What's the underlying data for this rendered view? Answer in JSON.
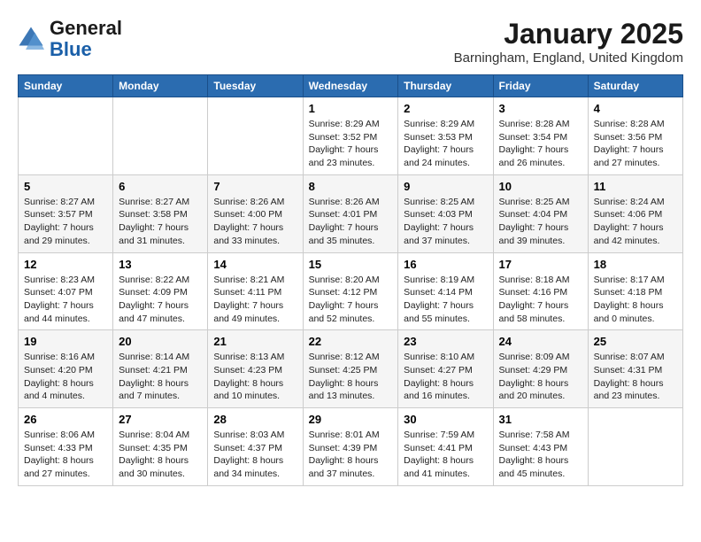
{
  "logo": {
    "general": "General",
    "blue": "Blue"
  },
  "title": "January 2025",
  "location": "Barningham, England, United Kingdom",
  "days_of_week": [
    "Sunday",
    "Monday",
    "Tuesday",
    "Wednesday",
    "Thursday",
    "Friday",
    "Saturday"
  ],
  "weeks": [
    [
      {
        "day": "",
        "info": ""
      },
      {
        "day": "",
        "info": ""
      },
      {
        "day": "",
        "info": ""
      },
      {
        "day": "1",
        "info": "Sunrise: 8:29 AM\nSunset: 3:52 PM\nDaylight: 7 hours\nand 23 minutes."
      },
      {
        "day": "2",
        "info": "Sunrise: 8:29 AM\nSunset: 3:53 PM\nDaylight: 7 hours\nand 24 minutes."
      },
      {
        "day": "3",
        "info": "Sunrise: 8:28 AM\nSunset: 3:54 PM\nDaylight: 7 hours\nand 26 minutes."
      },
      {
        "day": "4",
        "info": "Sunrise: 8:28 AM\nSunset: 3:56 PM\nDaylight: 7 hours\nand 27 minutes."
      }
    ],
    [
      {
        "day": "5",
        "info": "Sunrise: 8:27 AM\nSunset: 3:57 PM\nDaylight: 7 hours\nand 29 minutes."
      },
      {
        "day": "6",
        "info": "Sunrise: 8:27 AM\nSunset: 3:58 PM\nDaylight: 7 hours\nand 31 minutes."
      },
      {
        "day": "7",
        "info": "Sunrise: 8:26 AM\nSunset: 4:00 PM\nDaylight: 7 hours\nand 33 minutes."
      },
      {
        "day": "8",
        "info": "Sunrise: 8:26 AM\nSunset: 4:01 PM\nDaylight: 7 hours\nand 35 minutes."
      },
      {
        "day": "9",
        "info": "Sunrise: 8:25 AM\nSunset: 4:03 PM\nDaylight: 7 hours\nand 37 minutes."
      },
      {
        "day": "10",
        "info": "Sunrise: 8:25 AM\nSunset: 4:04 PM\nDaylight: 7 hours\nand 39 minutes."
      },
      {
        "day": "11",
        "info": "Sunrise: 8:24 AM\nSunset: 4:06 PM\nDaylight: 7 hours\nand 42 minutes."
      }
    ],
    [
      {
        "day": "12",
        "info": "Sunrise: 8:23 AM\nSunset: 4:07 PM\nDaylight: 7 hours\nand 44 minutes."
      },
      {
        "day": "13",
        "info": "Sunrise: 8:22 AM\nSunset: 4:09 PM\nDaylight: 7 hours\nand 47 minutes."
      },
      {
        "day": "14",
        "info": "Sunrise: 8:21 AM\nSunset: 4:11 PM\nDaylight: 7 hours\nand 49 minutes."
      },
      {
        "day": "15",
        "info": "Sunrise: 8:20 AM\nSunset: 4:12 PM\nDaylight: 7 hours\nand 52 minutes."
      },
      {
        "day": "16",
        "info": "Sunrise: 8:19 AM\nSunset: 4:14 PM\nDaylight: 7 hours\nand 55 minutes."
      },
      {
        "day": "17",
        "info": "Sunrise: 8:18 AM\nSunset: 4:16 PM\nDaylight: 7 hours\nand 58 minutes."
      },
      {
        "day": "18",
        "info": "Sunrise: 8:17 AM\nSunset: 4:18 PM\nDaylight: 8 hours\nand 0 minutes."
      }
    ],
    [
      {
        "day": "19",
        "info": "Sunrise: 8:16 AM\nSunset: 4:20 PM\nDaylight: 8 hours\nand 4 minutes."
      },
      {
        "day": "20",
        "info": "Sunrise: 8:14 AM\nSunset: 4:21 PM\nDaylight: 8 hours\nand 7 minutes."
      },
      {
        "day": "21",
        "info": "Sunrise: 8:13 AM\nSunset: 4:23 PM\nDaylight: 8 hours\nand 10 minutes."
      },
      {
        "day": "22",
        "info": "Sunrise: 8:12 AM\nSunset: 4:25 PM\nDaylight: 8 hours\nand 13 minutes."
      },
      {
        "day": "23",
        "info": "Sunrise: 8:10 AM\nSunset: 4:27 PM\nDaylight: 8 hours\nand 16 minutes."
      },
      {
        "day": "24",
        "info": "Sunrise: 8:09 AM\nSunset: 4:29 PM\nDaylight: 8 hours\nand 20 minutes."
      },
      {
        "day": "25",
        "info": "Sunrise: 8:07 AM\nSunset: 4:31 PM\nDaylight: 8 hours\nand 23 minutes."
      }
    ],
    [
      {
        "day": "26",
        "info": "Sunrise: 8:06 AM\nSunset: 4:33 PM\nDaylight: 8 hours\nand 27 minutes."
      },
      {
        "day": "27",
        "info": "Sunrise: 8:04 AM\nSunset: 4:35 PM\nDaylight: 8 hours\nand 30 minutes."
      },
      {
        "day": "28",
        "info": "Sunrise: 8:03 AM\nSunset: 4:37 PM\nDaylight: 8 hours\nand 34 minutes."
      },
      {
        "day": "29",
        "info": "Sunrise: 8:01 AM\nSunset: 4:39 PM\nDaylight: 8 hours\nand 37 minutes."
      },
      {
        "day": "30",
        "info": "Sunrise: 7:59 AM\nSunset: 4:41 PM\nDaylight: 8 hours\nand 41 minutes."
      },
      {
        "day": "31",
        "info": "Sunrise: 7:58 AM\nSunset: 4:43 PM\nDaylight: 8 hours\nand 45 minutes."
      },
      {
        "day": "",
        "info": ""
      }
    ]
  ]
}
